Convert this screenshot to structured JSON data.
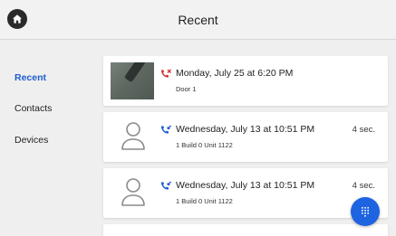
{
  "header": {
    "title": "Recent",
    "home_icon": "home-icon"
  },
  "sidebar": {
    "items": [
      {
        "label": "Recent",
        "active": true
      },
      {
        "label": "Contacts",
        "active": false
      },
      {
        "label": "Devices",
        "active": false
      }
    ]
  },
  "calls": [
    {
      "type": "missed",
      "title": "Monday, July 25 at 6:20 PM",
      "subtitle": "Door 1",
      "duration": "",
      "has_snapshot": true
    },
    {
      "type": "incoming",
      "title": "Wednesday, July 13 at 10:51 PM",
      "subtitle": "1 Build 0 Unit 1122",
      "duration": "4 sec.",
      "has_snapshot": false
    },
    {
      "type": "incoming",
      "title": "Wednesday, July 13 at 10:51 PM",
      "subtitle": "1 Build 0 Unit 1122",
      "duration": "4 sec.",
      "has_snapshot": false
    }
  ],
  "fab": {
    "icon": "dialpad-icon"
  },
  "colors": {
    "accent": "#1e5ccf",
    "fab": "#1e63e0",
    "missed": "#d32f2f",
    "incoming": "#1e5ccf"
  }
}
